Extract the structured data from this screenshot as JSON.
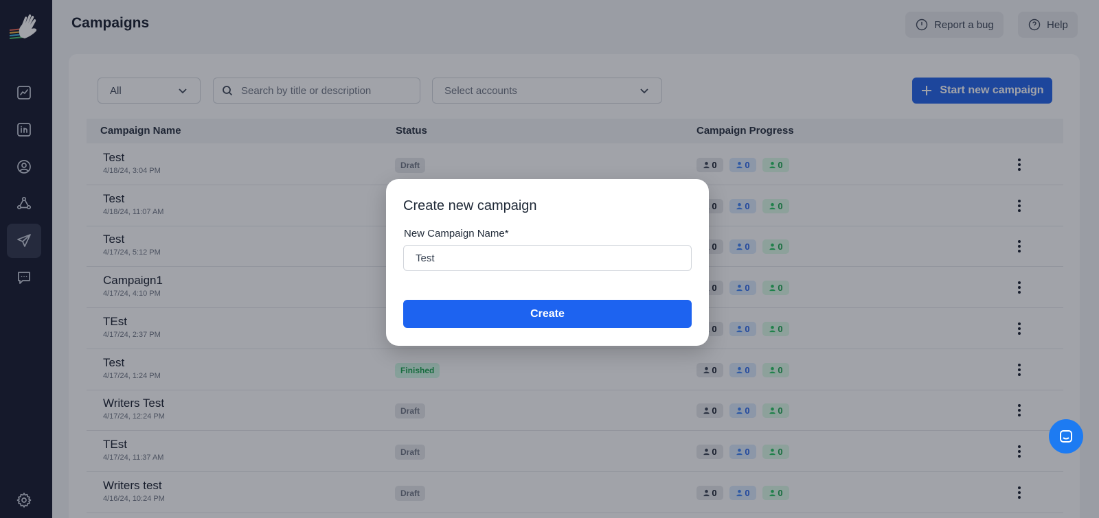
{
  "sidebar": {
    "logo": "waving-hand-logo",
    "items": [
      {
        "icon": "analytics-icon",
        "label": "analytics"
      },
      {
        "icon": "linkedin-icon",
        "label": "linkedin"
      },
      {
        "icon": "profile-icon",
        "label": "profile"
      },
      {
        "icon": "network-icon",
        "label": "network"
      },
      {
        "icon": "send-icon",
        "label": "campaigns",
        "active": true
      },
      {
        "icon": "messages-icon",
        "label": "messages"
      }
    ],
    "settings_icon": "gear-icon"
  },
  "header": {
    "title": "Campaigns",
    "report_bug": "Report a bug",
    "help": "Help"
  },
  "toolbar": {
    "filter_value": "All",
    "search_placeholder": "Search by title or description",
    "accounts_placeholder": "Select accounts",
    "start_button": "Start new campaign"
  },
  "table": {
    "headers": {
      "name": "Campaign Name",
      "status": "Status",
      "progress": "Campaign Progress"
    },
    "rows": [
      {
        "name": "Test",
        "date": "4/18/24, 3:04 PM",
        "status": "Draft",
        "p1": "0",
        "p2": "0",
        "p3": "0"
      },
      {
        "name": "Test",
        "date": "4/18/24, 11:07 AM",
        "status": "",
        "p1": "0",
        "p2": "0",
        "p3": "0"
      },
      {
        "name": "Test",
        "date": "4/17/24, 5:12 PM",
        "status": "",
        "p1": "0",
        "p2": "0",
        "p3": "0"
      },
      {
        "name": "Campaign1",
        "date": "4/17/24, 4:10 PM",
        "status": "",
        "p1": "0",
        "p2": "0",
        "p3": "0"
      },
      {
        "name": "TEst",
        "date": "4/17/24, 2:37 PM",
        "status": "",
        "p1": "0",
        "p2": "0",
        "p3": "0"
      },
      {
        "name": "Test",
        "date": "4/17/24, 1:24 PM",
        "status": "Finished",
        "p1": "0",
        "p2": "0",
        "p3": "0"
      },
      {
        "name": "Writers Test",
        "date": "4/17/24, 12:24 PM",
        "status": "Draft",
        "p1": "0",
        "p2": "0",
        "p3": "0"
      },
      {
        "name": "TEst",
        "date": "4/17/24, 11:37 AM",
        "status": "Draft",
        "p1": "0",
        "p2": "0",
        "p3": "0"
      },
      {
        "name": "Writers test",
        "date": "4/16/24, 10:24 PM",
        "status": "Draft",
        "p1": "0",
        "p2": "0",
        "p3": "0"
      }
    ]
  },
  "modal": {
    "title": "Create new campaign",
    "field_label": "New Campaign Name*",
    "field_value": "Test",
    "create_button": "Create"
  },
  "colors": {
    "primary": "#1d63f0",
    "sidebar": "#0e1226",
    "finished": "#16a34a"
  }
}
